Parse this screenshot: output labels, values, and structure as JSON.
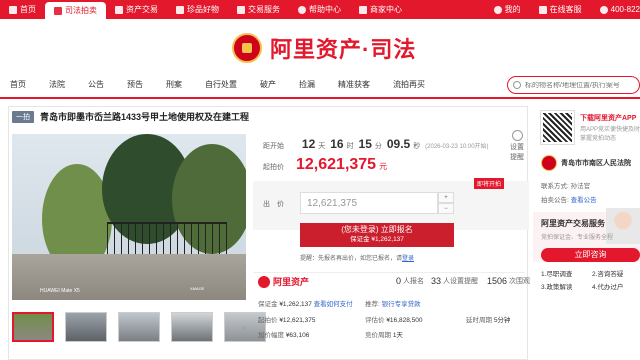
{
  "topbar": {
    "items": [
      {
        "label": "首页",
        "icon": "home-icon"
      },
      {
        "label": "司法拍卖",
        "icon": "hammer-icon",
        "active": true
      },
      {
        "label": "资产交易",
        "icon": "cart-icon"
      },
      {
        "label": "珍品好物",
        "icon": "gem-icon"
      },
      {
        "label": "交易服务",
        "icon": "flag-icon"
      },
      {
        "label": "帮助中心",
        "icon": "help-icon"
      },
      {
        "label": "商家中心",
        "icon": "store-icon"
      }
    ],
    "my": "我的",
    "service": "在线客服",
    "phone": "400-822"
  },
  "brand": {
    "title": "阿里资产·司法"
  },
  "nav": {
    "items": [
      "首页",
      "法院",
      "公告",
      "预告",
      "刑案",
      "自行处置",
      "破产",
      "捡漏",
      "精准获客",
      "流拍再买"
    ]
  },
  "search": {
    "placeholder": "标的物名称/地理位置/执行案号"
  },
  "lot": {
    "badge": "一拍",
    "title": "青岛市即墨市岙兰路1433号甲土地使用权及在建工程"
  },
  "photo": {
    "watermark_left": "HUAWEI Mate X5",
    "watermark_right": "XMAGE"
  },
  "countdown": {
    "label": "距开始",
    "d": "12",
    "d_unit": "天",
    "h": "16",
    "h_unit": "时",
    "m": "15",
    "m_unit": "分",
    "s": "09.5",
    "s_unit": "秒",
    "end": "(2026-03-23 10:00开始)"
  },
  "reminder": {
    "line1": "设置",
    "line2": "提醒"
  },
  "start_price": {
    "label": "起拍价",
    "value": "12,621,375",
    "unit": "元"
  },
  "bid": {
    "tag": "即将开拍",
    "label": "出　价",
    "value": "12,621,375",
    "btn_line1": "(您未登录) 立即报名",
    "btn_line2": "保证金 ¥1,262,137"
  },
  "tip": {
    "text": "提醒：先报名再出价，如您已报名，请",
    "link": "登录"
  },
  "stats": {
    "brand": "阿里资产",
    "applicants": "0",
    "applicants_label": "人报名",
    "reminders": "33",
    "reminders_label": "人设置提醒",
    "views": "1506",
    "views_label": "次围观"
  },
  "details": {
    "deposit_label": "保证金",
    "deposit": "¥1,262,137",
    "howpay": "查看如何支付",
    "recommend_label": "推荐:",
    "recommend": "银行专享贷款",
    "start_label": "起拍价",
    "start": "¥12,621,375",
    "eval_label": "评估价",
    "eval": "¥16,828,500",
    "delay_label": "延时周期",
    "delay": "5分钟",
    "inc_label": "加价幅度",
    "inc": "¥63,106",
    "period_label": "竞价周期",
    "period": "1天"
  },
  "sidebar": {
    "app_title": "下载阿里资产APP",
    "app_desc": "用APP竞买便快捷及时掌握竞拍动态",
    "court": "青岛市市南区人民法院",
    "contact_label": "联系方式:",
    "contact_name": "孙法官",
    "cat_label": "拍卖公告:",
    "cat_link": "查看公告",
    "svc_title": "阿里资产交易服务",
    "svc_desc": "竞拍保证金、专业服务全程",
    "reg": "立即咨询",
    "steps": [
      "1.尽职调查",
      "2.咨询答疑",
      "3.政策解读",
      "4.代办过户"
    ]
  }
}
